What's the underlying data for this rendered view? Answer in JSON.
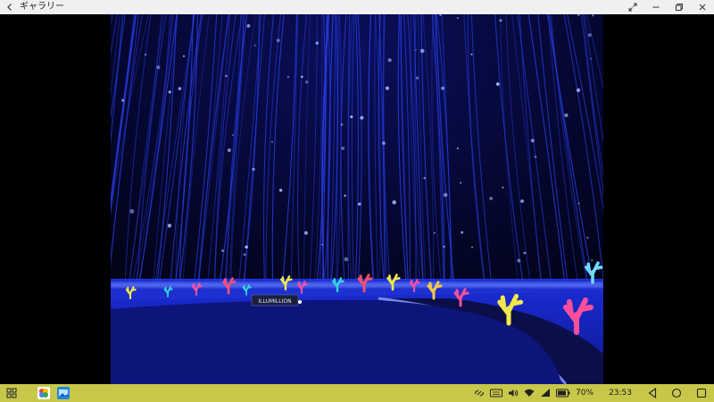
{
  "window": {
    "title": "ギャラリー"
  },
  "photo": {
    "sign_text": "ILLUMILLION"
  },
  "status": {
    "battery_percent": "70%",
    "time": "23:53"
  },
  "colors": {
    "titlebar_bg": "#f0f0f0",
    "taskbar_bg": "#c7c74a",
    "light_blue": "#3a4cff"
  },
  "icons": {
    "title_back": "chevron-left-icon",
    "title_buttons": [
      "expand-icon",
      "minimize-icon",
      "restore-icon",
      "close-icon"
    ],
    "taskbar_apps": [
      "apps-grid-icon",
      "photos-app-icon",
      "gallery-app-icon"
    ],
    "system_tray": [
      "link-icon",
      "keyboard-icon",
      "volume-icon",
      "wifi-icon",
      "signal-icon",
      "battery-icon"
    ],
    "nav_buttons": [
      "back-nav-icon",
      "home-nav-icon",
      "recents-nav-icon"
    ]
  }
}
